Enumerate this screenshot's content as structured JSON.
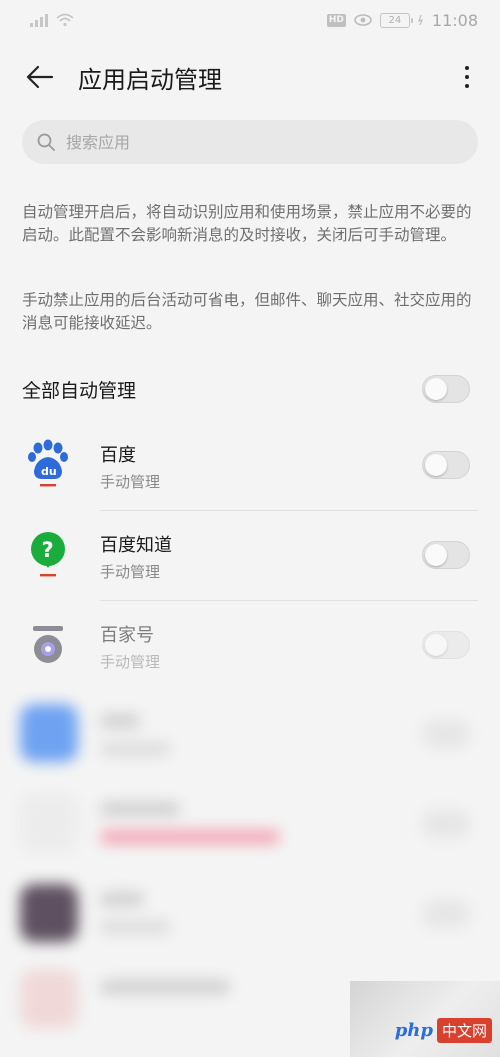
{
  "status_bar": {
    "hd_badge": "HD",
    "battery_level": "24",
    "time": "11:08"
  },
  "header": {
    "title": "应用启动管理"
  },
  "search": {
    "placeholder": "搜索应用"
  },
  "descriptions": [
    "自动管理开启后，将自动识别应用和使用场景，禁止应用不必要的启动。此配置不会影响新消息的及时接收，关闭后可手动管理。",
    "手动禁止应用的后台活动可省电，但邮件、聊天应用、社交应用的消息可能接收延迟。"
  ],
  "all_auto": {
    "label": "全部自动管理",
    "enabled": false
  },
  "apps": [
    {
      "name": "百度",
      "status": "手动管理",
      "enabled": false,
      "icon": "baidu-paw-icon"
    },
    {
      "name": "百度知道",
      "status": "手动管理",
      "enabled": false,
      "icon": "baidu-zhidao-icon"
    },
    {
      "name": "百家号",
      "status": "手动管理",
      "enabled": false,
      "icon": "baijiahao-icon"
    }
  ],
  "colors": {
    "baidu_blue": "#2f6bd8",
    "zhidao_green": "#1aad3d",
    "baijiahao_purple": "#6a5ae0",
    "accent_red": "#d8412d"
  },
  "watermark": {
    "php": "php",
    "cn": "中文网"
  }
}
